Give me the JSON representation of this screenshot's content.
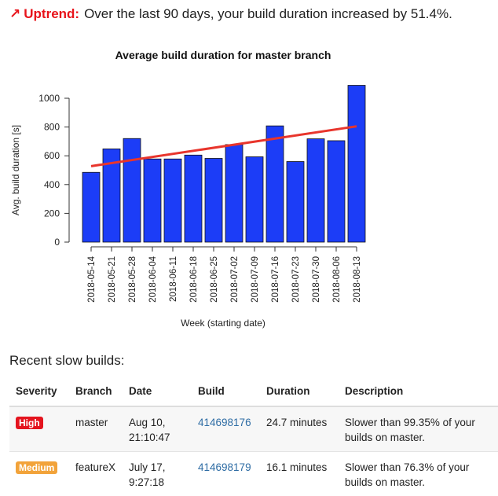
{
  "headline": {
    "arrow": "↗",
    "trend_label": "Uptrend:",
    "text": "Over the last 90 days, your build duration increased by 51.4%."
  },
  "colors": {
    "bar": "#1c3df7",
    "trend_line": "#e8352c",
    "alert": "#e8141b",
    "high_badge": "#e4141e",
    "medium_badge": "#f2a33a",
    "link": "#2e6ca4"
  },
  "chart_data": {
    "type": "bar",
    "title": "Average build duration for master branch",
    "xlabel": "Week (starting date)",
    "ylabel": "Avg. build duration [s]",
    "ylim": [
      0,
      1100
    ],
    "yticks": [
      0,
      200,
      400,
      600,
      800,
      1000
    ],
    "categories": [
      "2018-05-14",
      "2018-05-21",
      "2018-05-28",
      "2018-06-04",
      "2018-06-11",
      "2018-06-18",
      "2018-06-25",
      "2018-07-02",
      "2018-07-09",
      "2018-07-16",
      "2018-07-23",
      "2018-07-30",
      "2018-08-06",
      "2018-08-13"
    ],
    "values": [
      485,
      648,
      720,
      578,
      578,
      605,
      582,
      678,
      593,
      808,
      560,
      718,
      705,
      1090
    ],
    "trend_line": {
      "start": 528,
      "end": 805
    },
    "grid": false
  },
  "slow_builds": {
    "title": "Recent slow builds:",
    "columns": [
      "Severity",
      "Branch",
      "Date",
      "Build",
      "Duration",
      "Description"
    ],
    "rows": [
      {
        "severity": "High",
        "branch": "master",
        "date_line1": "Aug 10,",
        "date_line2": "21:10:47",
        "build": "414698176",
        "duration": "24.7 minutes",
        "desc_line1": "Slower than 99.35% of your",
        "desc_line2": "builds on master."
      },
      {
        "severity": "Medium",
        "branch": "featureX",
        "date_line1": "July 17,",
        "date_line2": "9:27:18",
        "build": "414698179",
        "duration": "16.1 minutes",
        "desc_line1": "Slower than 76.3% of your",
        "desc_line2": "builds on master."
      }
    ]
  }
}
